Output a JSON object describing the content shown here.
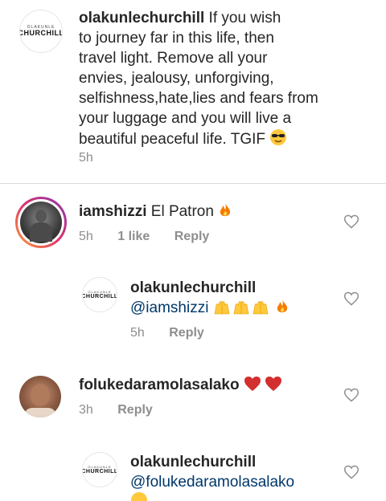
{
  "caption": {
    "username": "olakunlechurchill",
    "lines": [
      "If you wish",
      "to journey far in this life, then",
      "travel light. Remove all your",
      "envies, jealousy, unforgiving,",
      "selfishness,hate,lies and fears from",
      "your luggage and you will live a",
      "beautiful peaceful life.  TGIF"
    ],
    "time": "5h",
    "avatar_logo_top": "OLAKUNLE",
    "avatar_logo_bottom": "CHURCHILL"
  },
  "comments": [
    {
      "username": "iamshizzi",
      "text": "El Patron",
      "time": "5h",
      "likes": "1 like",
      "reply_label": "Reply",
      "icon": "fire-icon"
    },
    {
      "username": "olakunlechurchill",
      "mention": "@iamshizzi",
      "time": "5h",
      "reply_label": "Reply",
      "icon": "raised-hands-and-fire-icons"
    },
    {
      "username": "folukedaramolasalako",
      "time": "3h",
      "reply_label": "Reply",
      "icon": "red-hearts-icon"
    },
    {
      "username": "olakunlechurchill",
      "mention": "@folukedaramolasalako"
    }
  ],
  "colors": {
    "meta": "#8e8e8e",
    "mention": "#00376b",
    "fire": "#f57c00"
  }
}
